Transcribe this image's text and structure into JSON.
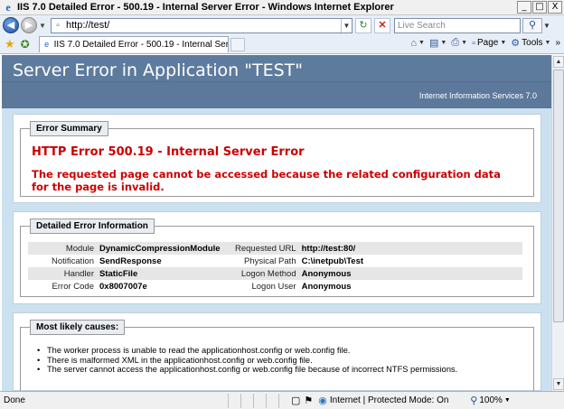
{
  "window": {
    "title": "IIS 7.0 Detailed Error - 500.19 - Internal Server Error - Windows Internet Explorer",
    "app_icon": "ie-icon",
    "controls": {
      "minimize": "_",
      "maximize": "□",
      "close": "X"
    }
  },
  "address_bar": {
    "url": "http://test/",
    "search_placeholder": "Live Search"
  },
  "tabs": [
    {
      "label": "IIS 7.0 Detailed Error - 500.19 - Internal Server Error"
    }
  ],
  "command_bar": {
    "page_label": "Page",
    "tools_label": "Tools"
  },
  "banner": {
    "title": "Server Error in Application \"TEST\"",
    "product": "Internet Information Services 7.0"
  },
  "error_summary": {
    "legend": "Error Summary",
    "heading": "HTTP Error 500.19 - Internal Server Error",
    "description": "The requested page cannot be accessed because the related configuration data for the page is invalid."
  },
  "detailed_error": {
    "legend": "Detailed Error Information",
    "rows": [
      {
        "label1": "Module",
        "value1": "DynamicCompressionModule",
        "label2": "Requested URL",
        "value2": "http://test:80/"
      },
      {
        "label1": "Notification",
        "value1": "SendResponse",
        "label2": "Physical Path",
        "value2": "C:\\inetpub\\Test"
      },
      {
        "label1": "Handler",
        "value1": "StaticFile",
        "label2": "Logon Method",
        "value2": "Anonymous"
      },
      {
        "label1": "Error Code",
        "value1": "0x8007007e",
        "label2": "Logon User",
        "value2": "Anonymous"
      }
    ]
  },
  "causes": {
    "legend": "Most likely causes:",
    "items": [
      "The worker process is unable to read the applicationhost.config or web.config file.",
      "There is malformed XML in the applicationhost.config or web.config file.",
      "The server cannot access the applicationhost.config or web.config file because of incorrect NTFS permissions."
    ]
  },
  "status_bar": {
    "status": "Done",
    "zone": "Internet | Protected Mode: On",
    "zoom": "100%"
  }
}
